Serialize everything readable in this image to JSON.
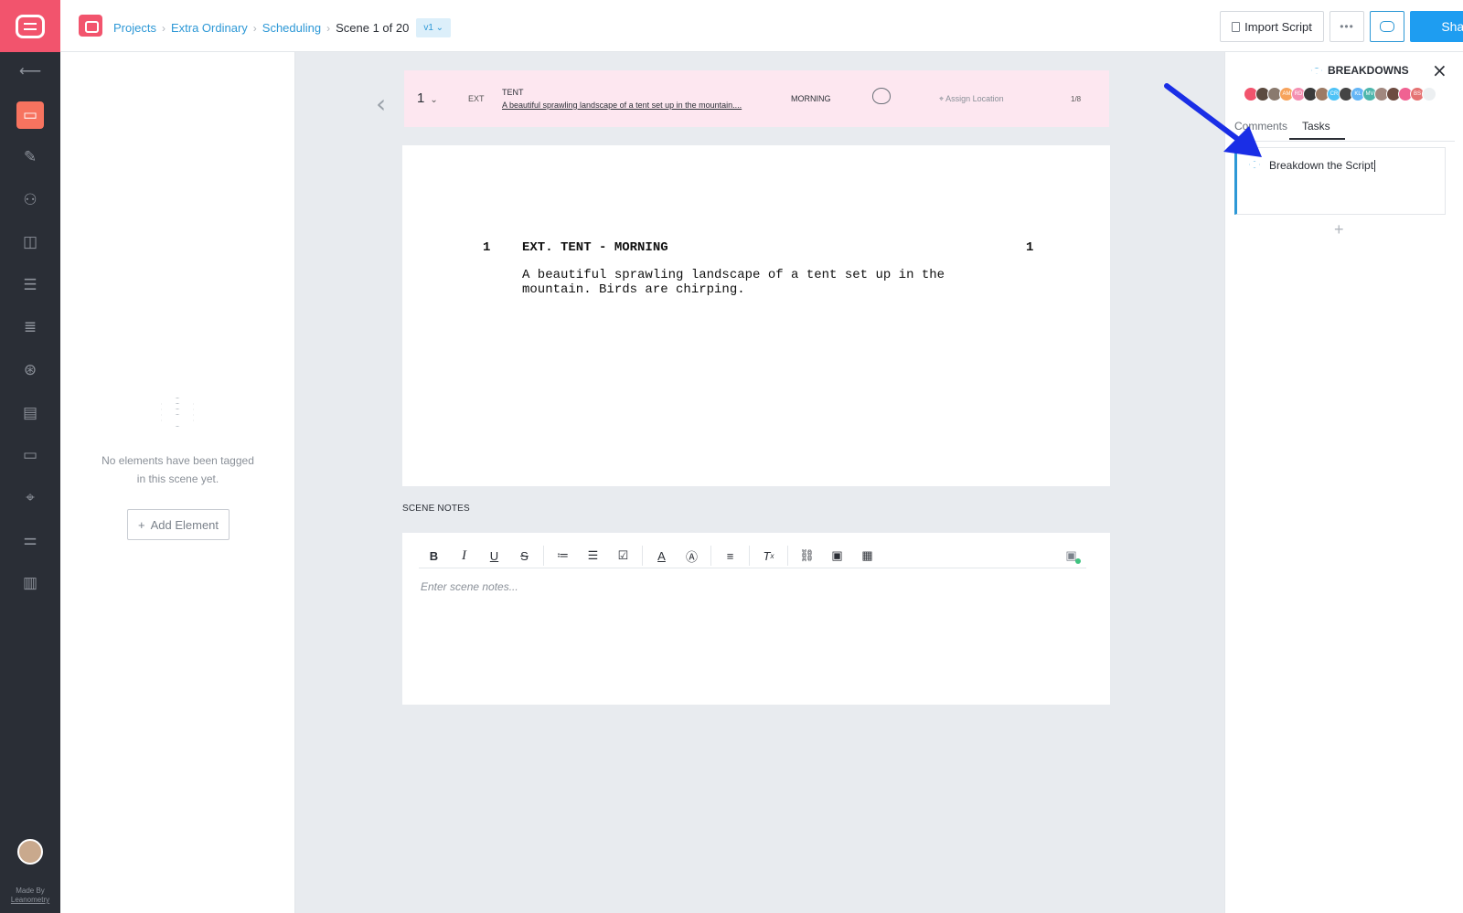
{
  "app": {
    "made_by": "Made By",
    "made_by_company": "Leanometry"
  },
  "breadcrumb": {
    "items": [
      "Projects",
      "Extra Ordinary",
      "Scheduling"
    ],
    "current": "Scene 1 of 20",
    "version": "v1 ⌄"
  },
  "header": {
    "import_label": "Import Script",
    "more_label": "•••",
    "share_label": "Share"
  },
  "elements_panel": {
    "empty_line1": "No elements have been tagged",
    "empty_line2": "in this scene yet.",
    "add_label": "Add Element"
  },
  "scene": {
    "number": "1",
    "int_ext": "EXT",
    "set": "TENT",
    "description": "A beautiful sprawling landscape of a tent set up in the mountain....",
    "time_of_day": "MORNING",
    "location_label": "Assign Location",
    "page_count": "1/8"
  },
  "script": {
    "scene_number": "1",
    "heading": "EXT. TENT - MORNING",
    "action_line1": "A beautiful sprawling landscape of a tent set up in the",
    "action_line2": "mountain. Birds are chirping."
  },
  "notes": {
    "label": "SCENE NOTES",
    "placeholder": "Enter scene notes..."
  },
  "breakdowns": {
    "title": "BREAKDOWNS",
    "avatars": [
      {
        "initials": "",
        "color": "#f2546d"
      },
      {
        "initials": "",
        "color": "#5b4a3f"
      },
      {
        "initials": "",
        "color": "#8a7a6e"
      },
      {
        "initials": "AM",
        "color": "#f7a35c"
      },
      {
        "initials": "RD",
        "color": "#f48fb1"
      },
      {
        "initials": "",
        "color": "#3b3b3b"
      },
      {
        "initials": "",
        "color": "#9c7b65"
      },
      {
        "initials": "CR",
        "color": "#4fc3f7"
      },
      {
        "initials": "",
        "color": "#454545"
      },
      {
        "initials": "KL",
        "color": "#64b5f6"
      },
      {
        "initials": "MV",
        "color": "#4db6ac"
      },
      {
        "initials": "",
        "color": "#a1887f"
      },
      {
        "initials": "",
        "color": "#6d4c41"
      },
      {
        "initials": "",
        "color": "#f06292"
      },
      {
        "initials": "BS",
        "color": "#e57373"
      },
      {
        "initials": "",
        "color": "#eceff1"
      }
    ],
    "tabs": [
      "Comments",
      "Tasks"
    ],
    "active_tab": "Tasks",
    "task_title": "Breakdown the Script",
    "add_icon": "+"
  },
  "colors": {
    "brand": "#f2546d",
    "accent": "#1e9df1",
    "link": "#2d98d6",
    "annotation_arrow": "#1a2ee6"
  }
}
